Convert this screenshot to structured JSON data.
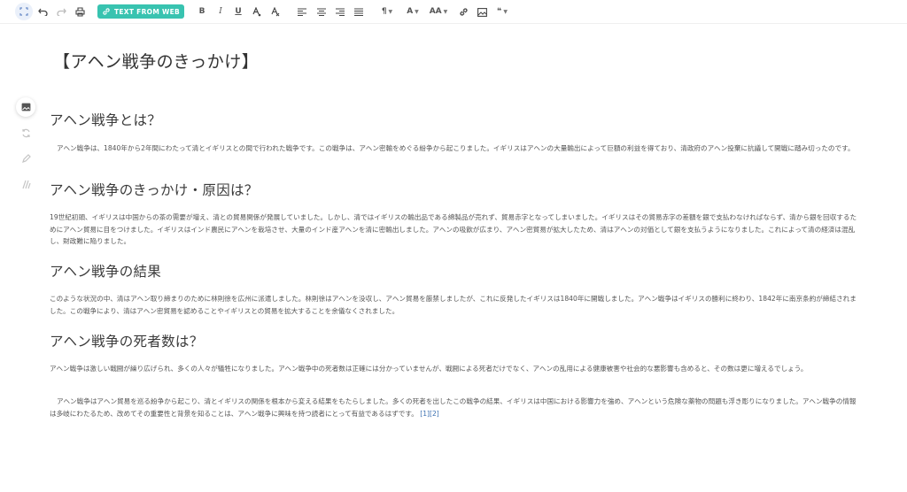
{
  "toolbar": {
    "text_from_web_label": "TEXT FROM WEB",
    "font_size_label": "AA"
  },
  "document": {
    "title": "【アヘン戦争のきっかけ】",
    "sections": [
      {
        "heading": "アヘン戦争とは？",
        "paragraphs": [
          "アヘン戦争は、1840年から2年間にわたって清とイギリスとの間で行われた戦争です。この戦争は、アヘン密輸をめぐる紛争から起こりました。イギリスはアヘンの大量輸出によって巨額の利益を得ており、清政府のアヘン投棄に抗議して開戦に踏み切ったのです。"
        ]
      },
      {
        "heading": "アヘン戦争のきっかけ・原因は？",
        "paragraphs": [
          "19世紀初頭、イギリスは中国からの茶の需要が増え、清との貿易関係が発展していました。しかし、清ではイギリスの輸出品である綿製品が売れず、貿易赤字となってしまいました。イギリスはその貿易赤字の差額を銀で支払わなければならず、清から銀を回収するためにアヘン貿易に目をつけました。イギリスはインド農民にアヘンを栽培させ、大量のインド産アヘンを清に密輸出しました。アヘンの吸飲が広まり、アヘン密貿易が拡大したため、清はアヘンの対価として銀を支払うようになりました。これによって清の経済は混乱し、財政難に陥りました。"
        ]
      },
      {
        "heading": "アヘン戦争の結果",
        "paragraphs": [
          "このような状況の中、清はアヘン取り締まりのために林則徐を広州に派遣しました。林則徐はアヘンを没収し、アヘン貿易を厳禁しましたが、これに反発したイギリスは1840年に開戦しました。アヘン戦争はイギリスの勝利に終わり、1842年に南京条約が締結されました。この戦争により、清はアヘン密貿易を認めることやイギリスとの貿易を拡大することを余儀なくされました。"
        ]
      },
      {
        "heading": "アヘン戦争の死者数は？",
        "paragraphs": [
          "アヘン戦争は激しい戦闘が繰り広げられ、多くの人々が犠牲になりました。アヘン戦争中の死者数は正確には分かっていませんが、戦闘による死者だけでなく、アヘンの乱用による健康被害や社会的な悪影響も含めると、その数は更に増えるでしょう。",
          "アヘン戦争はアヘン貿易を巡る紛争から起こり、清とイギリスの関係を根本から変える結果をもたらしました。多くの死者を出したこの戦争の結果、イギリスは中国における影響力を強め、アヘンという危険な薬物の問題も浮き彫りになりました。アヘン戦争の情報は多岐にわたるため、改めてその重要性と背景を知ることは、アヘン戦争に興味を持つ読者にとって有益であるはずです。"
        ],
        "citation": "[1][2]"
      }
    ]
  },
  "colors": {
    "accent": "#38c3b0",
    "link": "#3a6fb0"
  }
}
